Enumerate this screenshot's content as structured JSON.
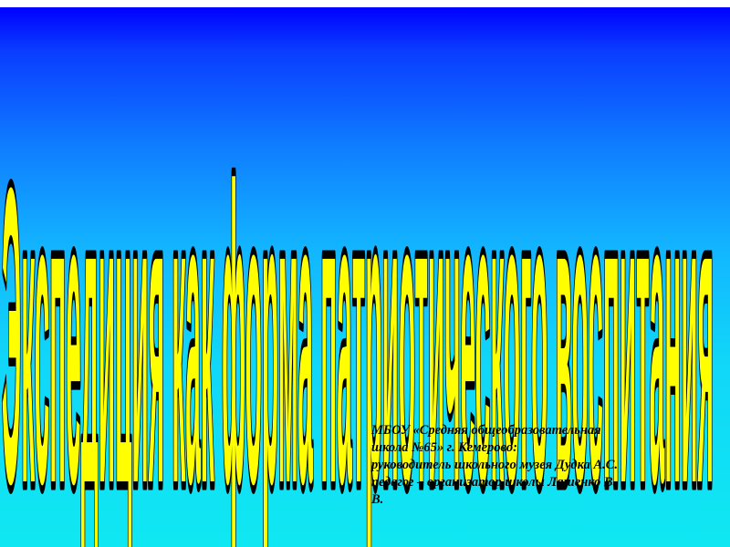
{
  "slide": {
    "title": "Экспедиция как форма патриотического воспитания",
    "title_color": "#ffff00",
    "title_outline_color": "#000000",
    "caption_lines": [
      "МБОУ «Средняя общеобразовательная",
      "школа №65» г. Кемерово:",
      "руководитель школьного музея Дудка А.С.",
      "педагог – организатор школы Ляшенко В.",
      "В."
    ],
    "background_gradient": [
      "#0000ff",
      "#0fe8f2"
    ]
  }
}
